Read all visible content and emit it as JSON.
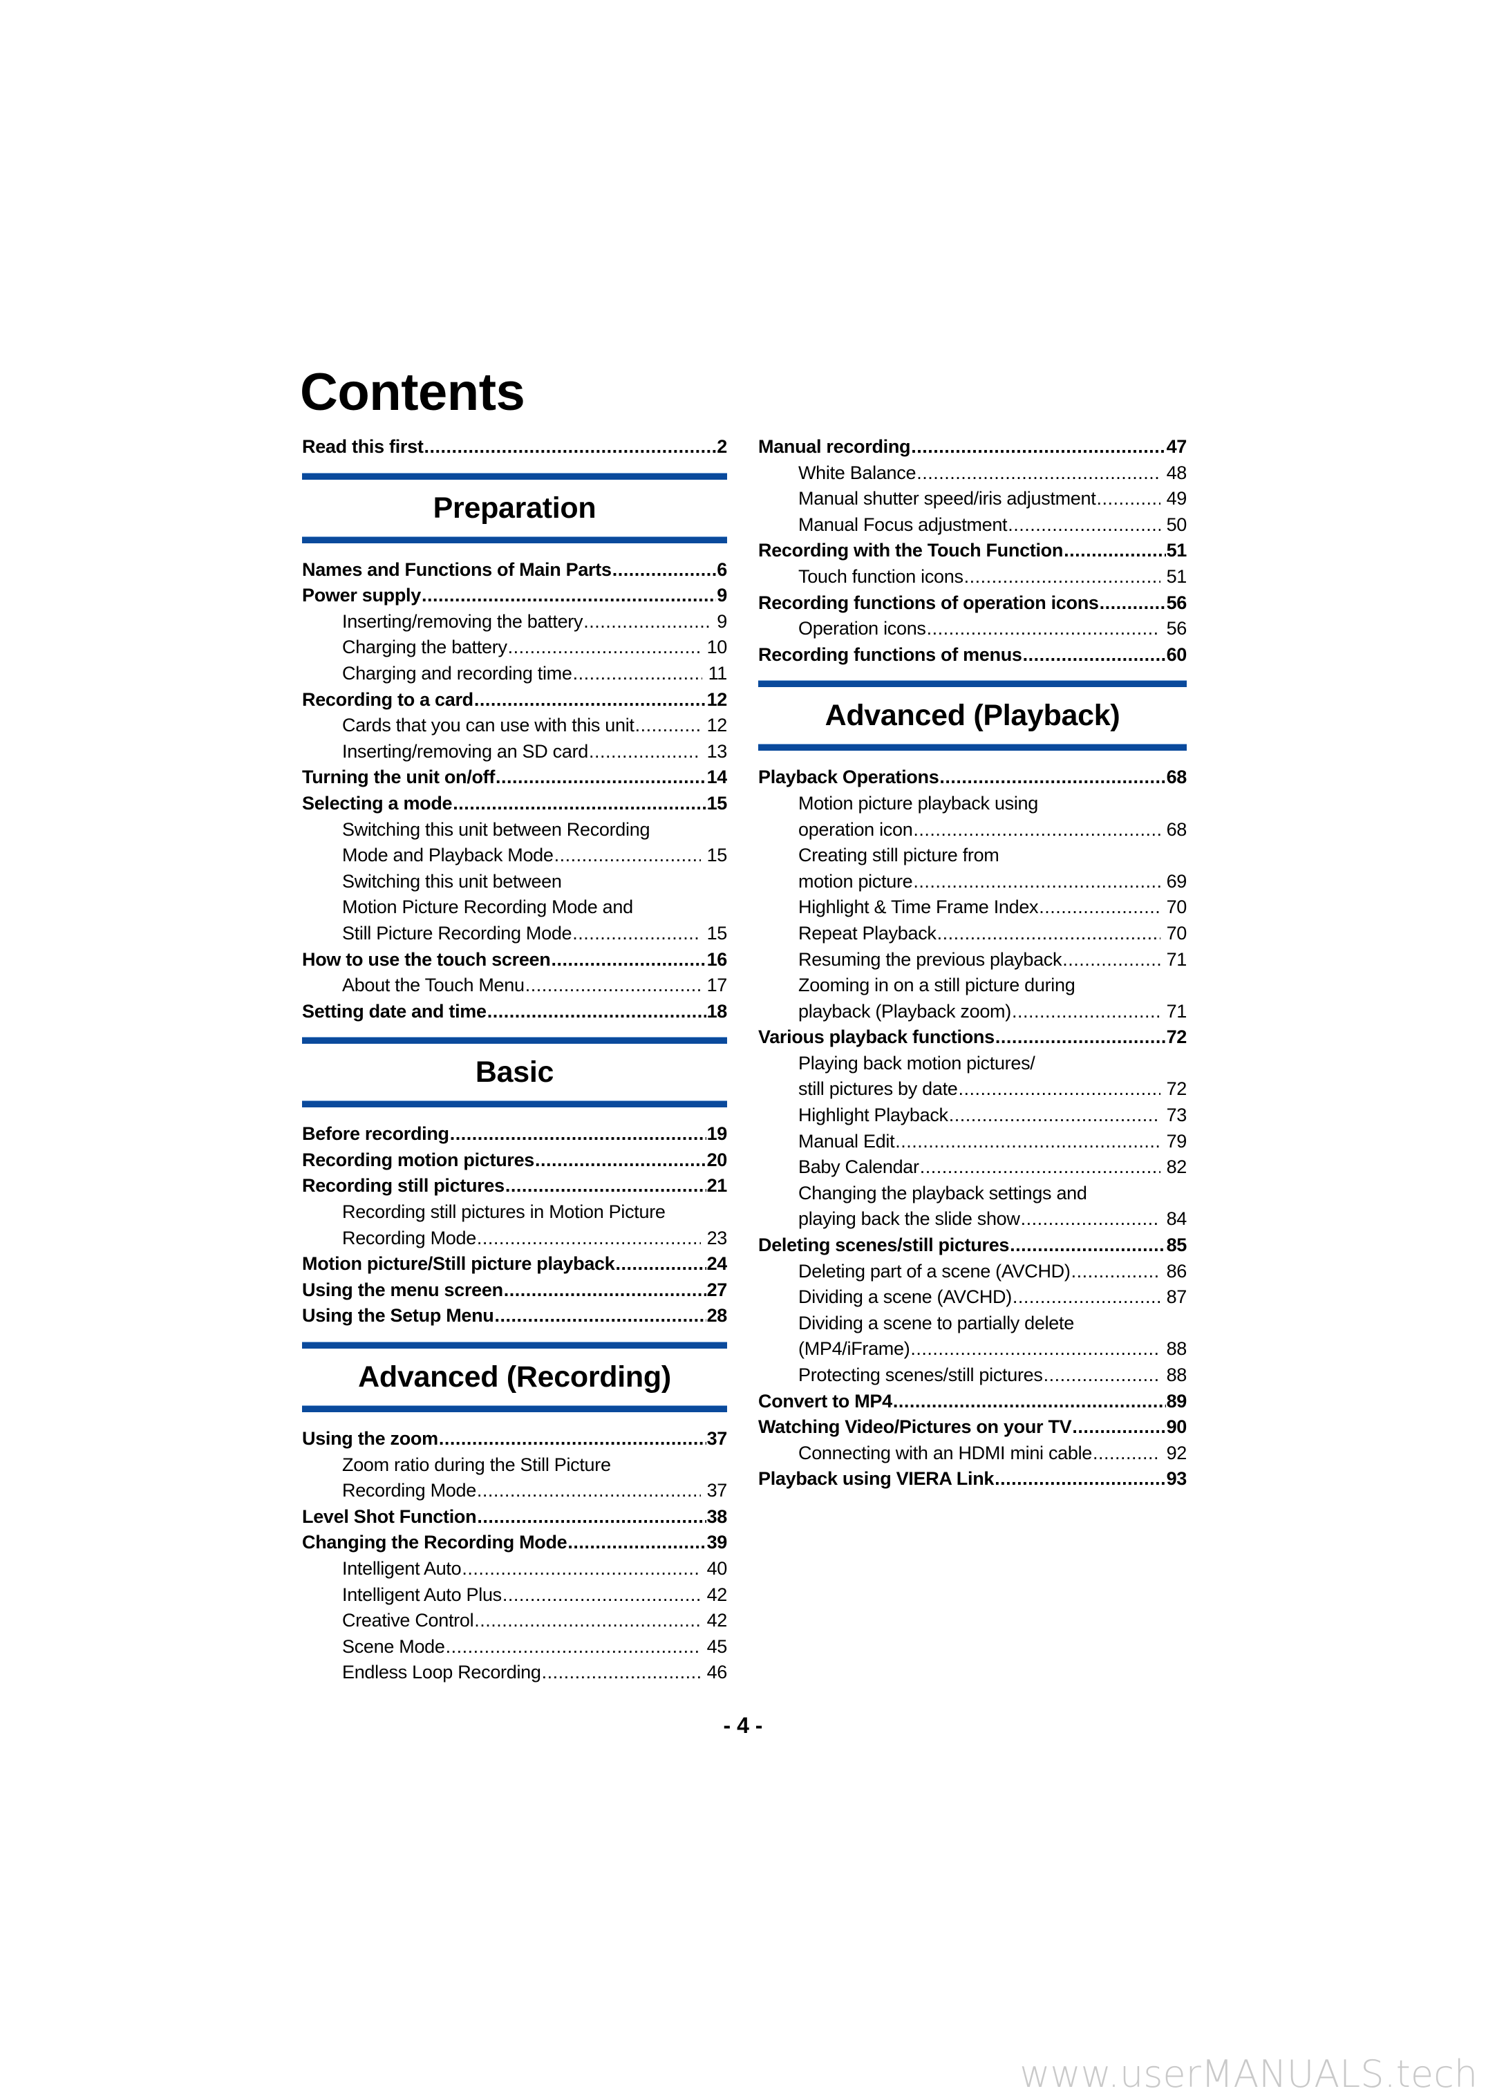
{
  "page": {
    "title": "Contents",
    "page_number": "- 4 -",
    "watermark": "www.userMANUALS.tech",
    "accent_color": "#0a4a9c"
  },
  "left_column": [
    {
      "type": "entry",
      "level": 1,
      "label": "Read this first",
      "page": "2"
    },
    {
      "type": "section",
      "title": "Preparation"
    },
    {
      "type": "entry",
      "level": 1,
      "label": "Names and Functions of Main Parts",
      "page": "6"
    },
    {
      "type": "entry",
      "level": 1,
      "label": "Power supply",
      "page": "9"
    },
    {
      "type": "entry",
      "level": 2,
      "label": "Inserting/removing the battery",
      "page": "9"
    },
    {
      "type": "entry",
      "level": 2,
      "label": "Charging the battery",
      "page": "10"
    },
    {
      "type": "entry",
      "level": 2,
      "label": "Charging and recording time",
      "page": "11"
    },
    {
      "type": "entry",
      "level": 1,
      "label": "Recording to a card",
      "page": "12"
    },
    {
      "type": "entry",
      "level": 2,
      "label": "Cards that you can use with this unit",
      "page": "12"
    },
    {
      "type": "entry",
      "level": 2,
      "label": "Inserting/removing an SD card",
      "page": "13"
    },
    {
      "type": "entry",
      "level": 1,
      "label": "Turning the unit on/off",
      "page": "14"
    },
    {
      "type": "entry",
      "level": 1,
      "label": "Selecting a mode",
      "page": "15"
    },
    {
      "type": "entry",
      "level": 2,
      "label": "Switching this unit between Recording",
      "page": null
    },
    {
      "type": "entry",
      "level": 2,
      "label": "Mode and Playback Mode",
      "page": "15"
    },
    {
      "type": "entry",
      "level": 2,
      "label": "Switching this unit between",
      "page": null
    },
    {
      "type": "entry",
      "level": 2,
      "label": "Motion Picture Recording Mode and",
      "page": null
    },
    {
      "type": "entry",
      "level": 2,
      "label": "Still Picture Recording Mode",
      "page": "15"
    },
    {
      "type": "entry",
      "level": 1,
      "label": "How to use the touch screen",
      "page": "16"
    },
    {
      "type": "entry",
      "level": 2,
      "label": "About the Touch Menu",
      "page": "17"
    },
    {
      "type": "entry",
      "level": 1,
      "label": "Setting date and time",
      "page": "18"
    },
    {
      "type": "section",
      "title": "Basic"
    },
    {
      "type": "entry",
      "level": 1,
      "label": "Before recording",
      "page": "19"
    },
    {
      "type": "entry",
      "level": 1,
      "label": "Recording motion pictures",
      "page": "20"
    },
    {
      "type": "entry",
      "level": 1,
      "label": "Recording still pictures",
      "page": "21"
    },
    {
      "type": "entry",
      "level": 2,
      "label": "Recording still pictures in Motion Picture",
      "page": null
    },
    {
      "type": "entry",
      "level": 2,
      "label": "Recording Mode",
      "page": "23"
    },
    {
      "type": "entry",
      "level": 1,
      "label": "Motion picture/Still picture playback",
      "page": "24"
    },
    {
      "type": "entry",
      "level": 1,
      "label": "Using the menu screen",
      "page": "27"
    },
    {
      "type": "entry",
      "level": 1,
      "label": "Using the Setup Menu",
      "page": "28"
    },
    {
      "type": "section",
      "title": "Advanced (Recording)"
    },
    {
      "type": "entry",
      "level": 1,
      "label": "Using the zoom",
      "page": "37"
    },
    {
      "type": "entry",
      "level": 2,
      "label": "Zoom ratio during the Still Picture",
      "page": null
    },
    {
      "type": "entry",
      "level": 2,
      "label": "Recording Mode",
      "page": "37"
    },
    {
      "type": "entry",
      "level": 1,
      "label": "Level Shot Function",
      "page": "38"
    },
    {
      "type": "entry",
      "level": 1,
      "label": "Changing the Recording Mode",
      "page": "39"
    },
    {
      "type": "entry",
      "level": 2,
      "label": "Intelligent Auto",
      "page": "40"
    },
    {
      "type": "entry",
      "level": 2,
      "label": "Intelligent Auto Plus",
      "page": "42"
    },
    {
      "type": "entry",
      "level": 2,
      "label": "Creative Control",
      "page": "42"
    },
    {
      "type": "entry",
      "level": 2,
      "label": "Scene Mode",
      "page": "45"
    },
    {
      "type": "entry",
      "level": 2,
      "label": "Endless Loop Recording",
      "page": "46"
    }
  ],
  "right_column": [
    {
      "type": "entry",
      "level": 1,
      "label": "Manual recording",
      "page": "47"
    },
    {
      "type": "entry",
      "level": 2,
      "label": "White Balance",
      "page": "48"
    },
    {
      "type": "entry",
      "level": 2,
      "label": "Manual shutter speed/iris adjustment",
      "page": "49"
    },
    {
      "type": "entry",
      "level": 2,
      "label": "Manual Focus adjustment",
      "page": "50"
    },
    {
      "type": "entry",
      "level": 1,
      "label": "Recording with the Touch Function",
      "page": "51"
    },
    {
      "type": "entry",
      "level": 2,
      "label": "Touch function icons",
      "page": "51"
    },
    {
      "type": "entry",
      "level": 1,
      "label": "Recording functions of operation icons",
      "page": "56"
    },
    {
      "type": "entry",
      "level": 2,
      "label": "Operation icons",
      "page": "56"
    },
    {
      "type": "entry",
      "level": 1,
      "label": "Recording functions of menus",
      "page": "60"
    },
    {
      "type": "section",
      "title": "Advanced (Playback)"
    },
    {
      "type": "entry",
      "level": 1,
      "label": "Playback Operations",
      "page": "68"
    },
    {
      "type": "entry",
      "level": 2,
      "label": "Motion picture playback using",
      "page": null
    },
    {
      "type": "entry",
      "level": 2,
      "label": "operation icon",
      "page": "68"
    },
    {
      "type": "entry",
      "level": 2,
      "label": "Creating still picture from",
      "page": null
    },
    {
      "type": "entry",
      "level": 2,
      "label": "motion picture",
      "page": "69"
    },
    {
      "type": "entry",
      "level": 2,
      "label": "Highlight & Time Frame Index",
      "page": "70"
    },
    {
      "type": "entry",
      "level": 2,
      "label": "Repeat Playback",
      "page": "70"
    },
    {
      "type": "entry",
      "level": 2,
      "label": "Resuming the previous playback",
      "page": "71"
    },
    {
      "type": "entry",
      "level": 2,
      "label": "Zooming in on a still picture during",
      "page": null
    },
    {
      "type": "entry",
      "level": 2,
      "label": "playback (Playback zoom)",
      "page": "71"
    },
    {
      "type": "entry",
      "level": 1,
      "label": "Various playback functions",
      "page": "72"
    },
    {
      "type": "entry",
      "level": 2,
      "label": "Playing back motion pictures/",
      "page": null
    },
    {
      "type": "entry",
      "level": 2,
      "label": "still pictures by date",
      "page": "72"
    },
    {
      "type": "entry",
      "level": 2,
      "label": "Highlight Playback",
      "page": "73"
    },
    {
      "type": "entry",
      "level": 2,
      "label": "Manual Edit",
      "page": "79"
    },
    {
      "type": "entry",
      "level": 2,
      "label": "Baby Calendar",
      "page": "82"
    },
    {
      "type": "entry",
      "level": 2,
      "label": "Changing the playback settings and",
      "page": null
    },
    {
      "type": "entry",
      "level": 2,
      "label": "playing back the slide show",
      "page": "84"
    },
    {
      "type": "entry",
      "level": 1,
      "label": "Deleting scenes/still pictures",
      "page": "85"
    },
    {
      "type": "entry",
      "level": 2,
      "label": "Deleting part of a scene (AVCHD)",
      "page": "86"
    },
    {
      "type": "entry",
      "level": 2,
      "label": "Dividing a scene (AVCHD)",
      "page": "87"
    },
    {
      "type": "entry",
      "level": 2,
      "label": "Dividing a scene to partially delete",
      "page": null
    },
    {
      "type": "entry",
      "level": 2,
      "label": "(MP4/iFrame)",
      "page": "88"
    },
    {
      "type": "entry",
      "level": 2,
      "label": "Protecting scenes/still pictures",
      "page": "88"
    },
    {
      "type": "entry",
      "level": 1,
      "label": "Convert to MP4",
      "page": "89"
    },
    {
      "type": "entry",
      "level": 1,
      "label": "Watching Video/Pictures on your TV",
      "page": "90"
    },
    {
      "type": "entry",
      "level": 2,
      "label": "Connecting with an HDMI mini cable",
      "page": "92"
    },
    {
      "type": "entry",
      "level": 1,
      "label": "Playback using VIERA Link",
      "page": "93"
    }
  ]
}
